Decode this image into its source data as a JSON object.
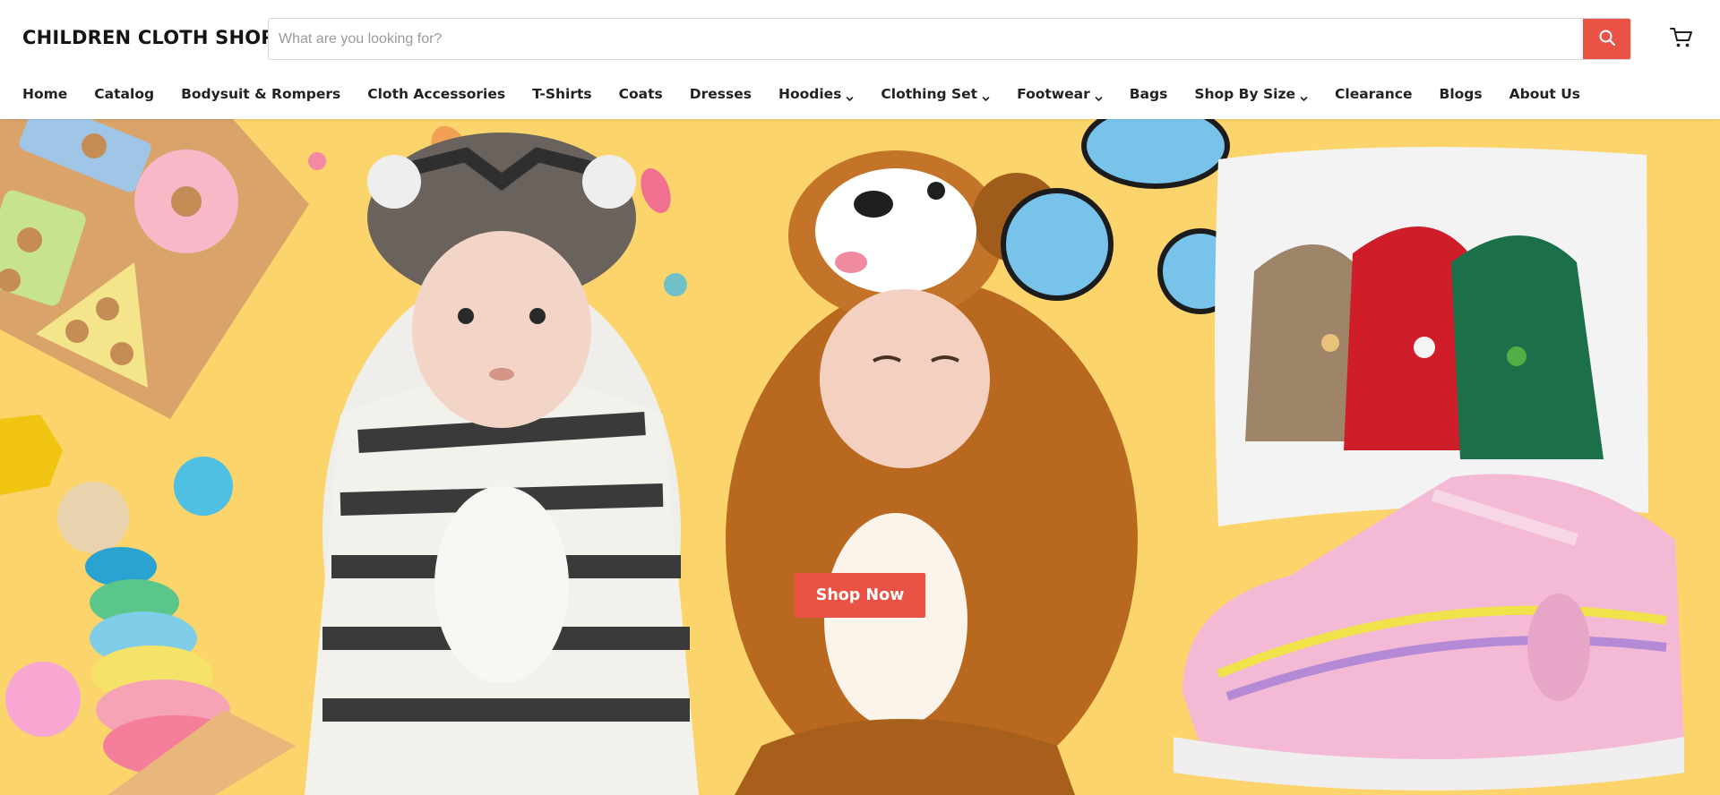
{
  "header": {
    "logo": "CHILDREN CLOTH SHOP",
    "search_placeholder": "What are you looking for?",
    "search_value": "",
    "search_icon": "search-icon",
    "cart_icon": "cart-icon"
  },
  "nav": {
    "items": [
      {
        "label": "Home",
        "dropdown": false
      },
      {
        "label": "Catalog",
        "dropdown": false
      },
      {
        "label": "Bodysuit & Rompers",
        "dropdown": false
      },
      {
        "label": "Cloth Accessories",
        "dropdown": false
      },
      {
        "label": "T-Shirts",
        "dropdown": false
      },
      {
        "label": "Coats",
        "dropdown": false
      },
      {
        "label": "Dresses",
        "dropdown": false
      },
      {
        "label": "Hoodies",
        "dropdown": true
      },
      {
        "label": "Clothing Set",
        "dropdown": true
      },
      {
        "label": "Footwear",
        "dropdown": true
      },
      {
        "label": "Bags",
        "dropdown": false
      },
      {
        "label": "Shop By Size",
        "dropdown": true
      },
      {
        "label": "Clearance",
        "dropdown": false
      },
      {
        "label": "Blogs",
        "dropdown": false
      },
      {
        "label": "About Us",
        "dropdown": false
      }
    ]
  },
  "hero": {
    "cta_label": "Shop Now",
    "background_color": "#fbd46c"
  },
  "colors": {
    "accent": "#e95244",
    "text": "#222222",
    "hero_background": "#fbd46c"
  }
}
